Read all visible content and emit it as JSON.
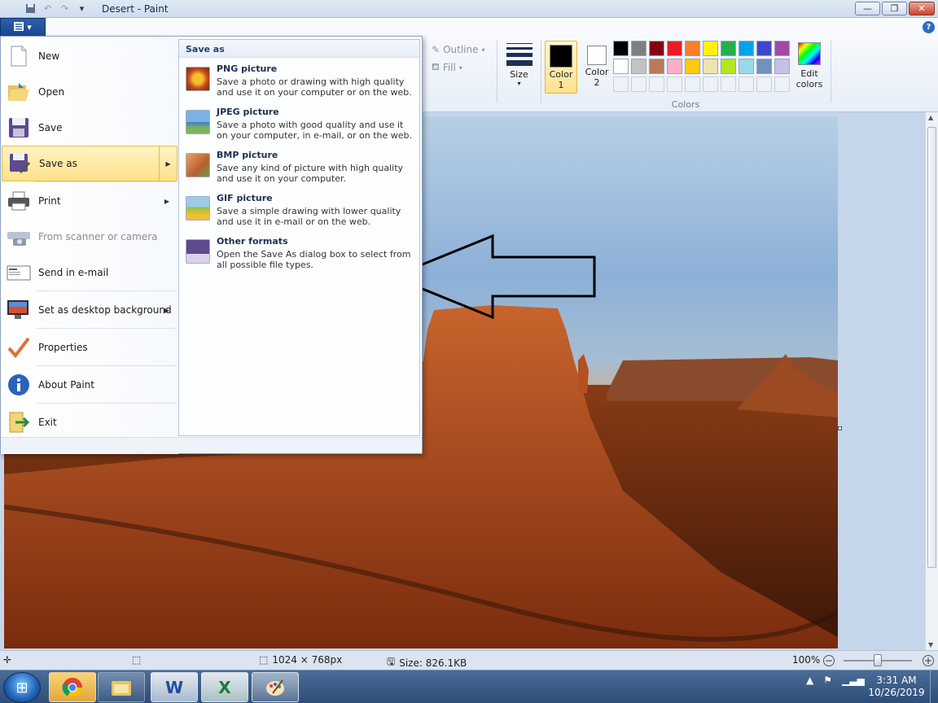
{
  "window": {
    "title": "Desert - Paint",
    "buttons": {
      "minimize": "—",
      "restore": "❐",
      "close": "✕"
    }
  },
  "ribbon": {
    "file_tab_icon": "paint-menu-icon",
    "help": "?",
    "outline_label": "Outline",
    "fill_label": "Fill",
    "size_label": "Size",
    "color1_label_line1": "Color",
    "color1_label_line2": "1",
    "color2_label_line1": "Color",
    "color2_label_line2": "2",
    "color1_value": "#000000",
    "color2_value": "#ffffff",
    "colors_group_label": "Colors",
    "edit_colors_line1": "Edit",
    "edit_colors_line2": "colors",
    "palette": [
      "#000000",
      "#7f7f7f",
      "#880015",
      "#ed1c24",
      "#ff7f27",
      "#fff200",
      "#22b14c",
      "#00a2e8",
      "#3f48cc",
      "#a349a4",
      "#ffffff",
      "#c3c3c3",
      "#b97a57",
      "#ffaec9",
      "#ffc90e",
      "#efe4b0",
      "#b5e61d",
      "#99d9ea",
      "#7092be",
      "#c8bfe7",
      "",
      "",
      "",
      "",
      "",
      "",
      "",
      "",
      "",
      ""
    ]
  },
  "file_menu": {
    "items": [
      {
        "label": "New",
        "icon": "new-file-icon",
        "arrow": false,
        "disabled": false
      },
      {
        "label": "Open",
        "icon": "open-folder-icon",
        "arrow": false,
        "disabled": false
      },
      {
        "label": "Save",
        "icon": "save-disk-icon",
        "arrow": false,
        "disabled": false
      },
      {
        "label": "Save as",
        "icon": "save-as-icon",
        "arrow": true,
        "disabled": false,
        "highlighted": true
      },
      {
        "label": "Print",
        "icon": "printer-icon",
        "arrow": true,
        "disabled": false
      },
      {
        "label": "From scanner or camera",
        "icon": "scanner-icon",
        "arrow": false,
        "disabled": true
      },
      {
        "label": "Send in e-mail",
        "icon": "email-icon",
        "arrow": false,
        "disabled": false
      },
      {
        "label": "Set as desktop background",
        "icon": "desktop-icon",
        "arrow": true,
        "disabled": false
      },
      {
        "label": "Properties",
        "icon": "checkmark-icon",
        "arrow": false,
        "disabled": false
      },
      {
        "label": "About Paint",
        "icon": "info-icon",
        "arrow": false,
        "disabled": false
      },
      {
        "label": "Exit",
        "icon": "exit-icon",
        "arrow": false,
        "disabled": false
      }
    ],
    "save_as_panel": {
      "heading": "Save as",
      "formats": [
        {
          "name": "PNG picture",
          "desc": "Save a photo or drawing with high quality and use it on your computer or on the web.",
          "icon": "png-flower-icon"
        },
        {
          "name": "JPEG picture",
          "desc": "Save a photo with good quality and use it on your computer, in e-mail, or on the web.",
          "icon": "jpeg-landscape-icon"
        },
        {
          "name": "BMP picture",
          "desc": "Save any kind of picture with high quality and use it on your computer.",
          "icon": "bmp-paint-icon"
        },
        {
          "name": "GIF picture",
          "desc": "Save a simple drawing with lower quality and use it in e-mail or on the web.",
          "icon": "gif-shapes-icon"
        },
        {
          "name": "Other formats",
          "desc": "Open the Save As dialog box to select from all possible file types.",
          "icon": "other-formats-icon"
        }
      ]
    }
  },
  "status_bar": {
    "dimensions": "1024 × 768px",
    "size": "Size: 826.1KB",
    "zoom": "100%",
    "zoom_minus": "−",
    "zoom_plus": "+",
    "zoom_fraction": 0.5
  },
  "taskbar": {
    "start_icon": "windows-start-icon",
    "apps": [
      "chrome-icon",
      "file-explorer-icon",
      "word-icon",
      "excel-icon",
      "paint-icon"
    ],
    "time": "3:31 AM",
    "date": "10/26/2019"
  }
}
